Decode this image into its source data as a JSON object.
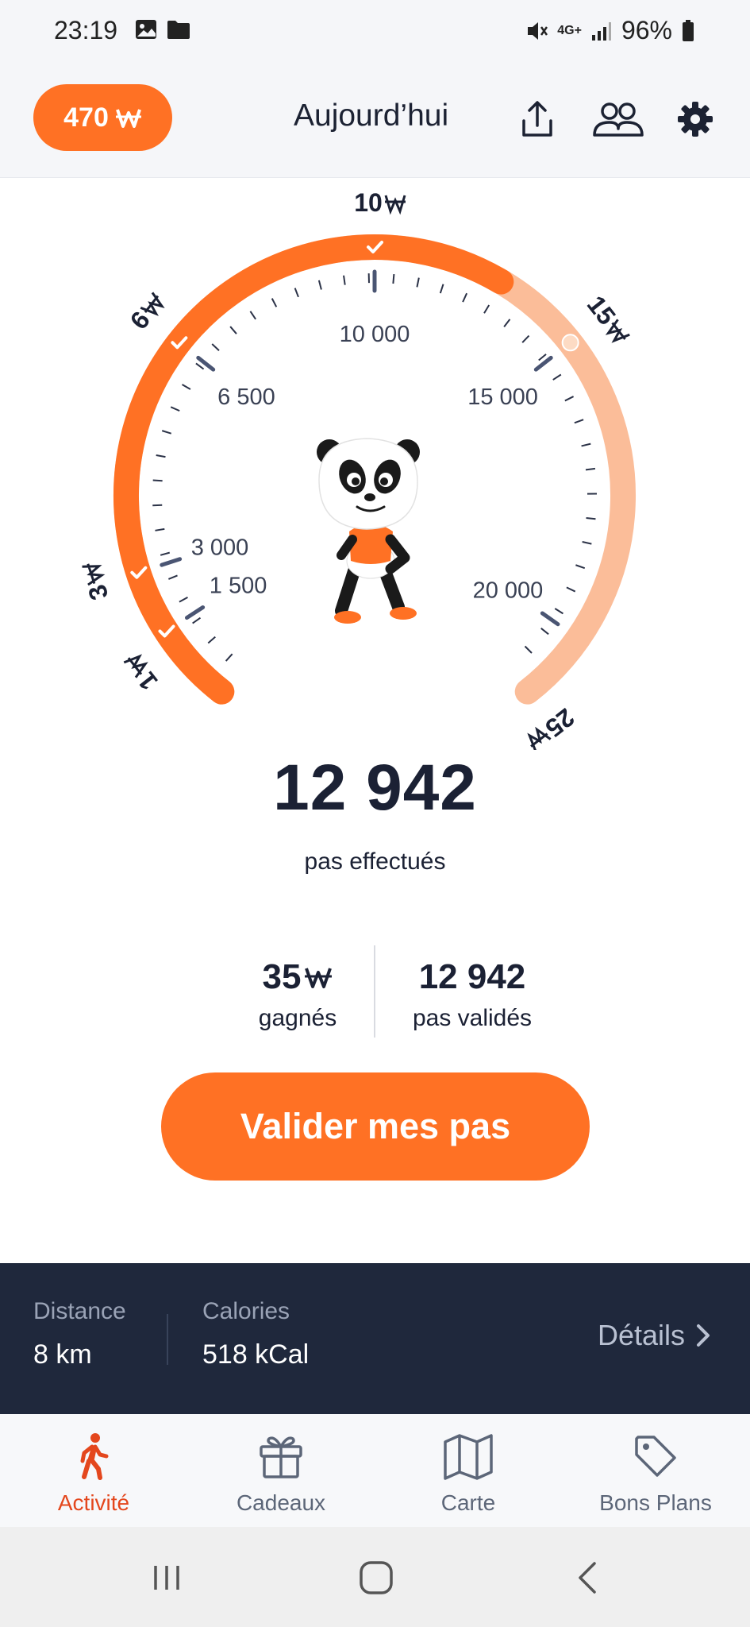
{
  "status_bar": {
    "time": "23:19",
    "network": "4G+",
    "battery": "96%"
  },
  "header": {
    "wallet_amount": "470",
    "title": "Aujourd’hui"
  },
  "gauge": {
    "steps_today": 12942,
    "step_ticks": [
      "1 500",
      "3 000",
      "6 500",
      "10 000",
      "15 000",
      "20 000"
    ],
    "reward_labels": [
      "1",
      "3",
      "6",
      "10",
      "15",
      "25"
    ],
    "completed_rewards": [
      "1",
      "3",
      "6",
      "10"
    ],
    "colors": {
      "progress": "#ff7124",
      "remaining": "#fbbd99"
    }
  },
  "steps": {
    "count": "12 942",
    "label": "pas effectués"
  },
  "summary": {
    "earned_value": "35",
    "earned_label": "gagnés",
    "validated_value": "12 942",
    "validated_label": "pas validés"
  },
  "validate_button": "Valider mes pas",
  "info_bar": {
    "distance_label": "Distance",
    "distance_value": "8 km",
    "calories_label": "Calories",
    "calories_value": "518 kCal",
    "details_label": "Détails"
  },
  "bottom_nav": [
    {
      "label": "Activité",
      "icon": "walking-icon",
      "active": true
    },
    {
      "label": "Cadeaux",
      "icon": "gift-icon",
      "active": false
    },
    {
      "label": "Carte",
      "icon": "map-icon",
      "active": false
    },
    {
      "label": "Bons Plans",
      "icon": "tag-icon",
      "active": false
    }
  ]
}
